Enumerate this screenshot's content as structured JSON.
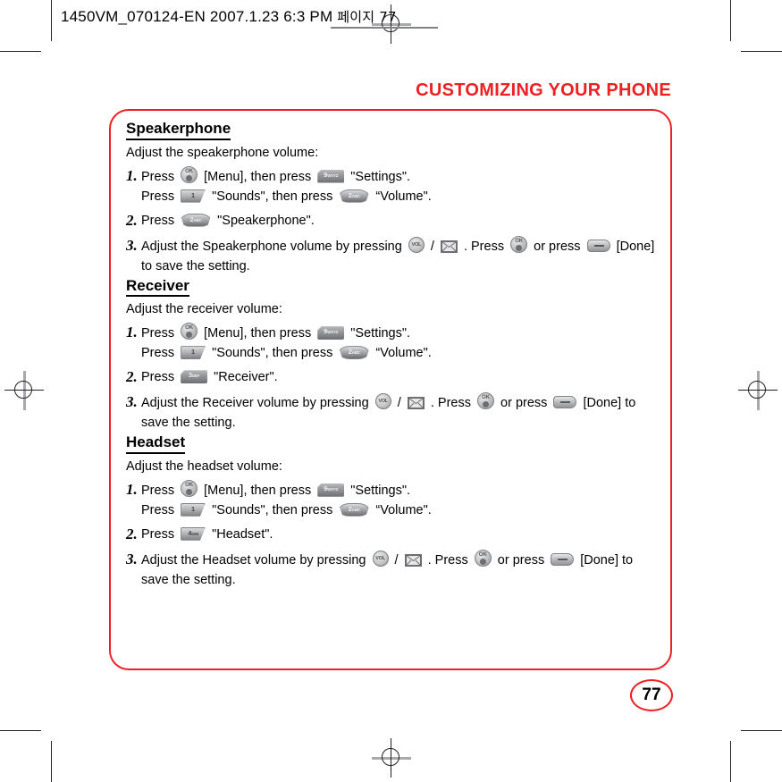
{
  "document": {
    "header_text": "1450VM_070124-EN  2007.1.23 6:3 PM",
    "header_korean": "페이지 77",
    "chapter_title": "CUSTOMIZING YOUR PHONE",
    "page_number": "77",
    "accent_color": "#ed2024"
  },
  "icons": {
    "ok_label": "OK",
    "vol_label": "VOL",
    "key_1": "1",
    "key_1_alpha": "",
    "key_2_digit": "2",
    "key_2_alpha": "ABC",
    "key_3_digit": "3",
    "key_3_alpha": "DEF",
    "key_4_digit": "4",
    "key_4_alpha": "GHI",
    "key_9_digit": "9",
    "key_9_alpha": "WXYZ"
  },
  "sections": [
    {
      "heading": "Speakerphone",
      "subtitle": "Adjust the speakerphone volume:",
      "steps": [
        {
          "number": "1.",
          "lines": [
            {
              "parts": [
                {
                  "type": "text",
                  "value": "Press "
                },
                {
                  "type": "icon",
                  "icon": "ok-key"
                },
                {
                  "type": "text",
                  "value": " [Menu], then press "
                },
                {
                  "type": "icon",
                  "icon": "key-9"
                },
                {
                  "type": "text",
                  "value": " \"Settings\"."
                }
              ]
            },
            {
              "parts": [
                {
                  "type": "text",
                  "value": "Press "
                },
                {
                  "type": "icon",
                  "icon": "key-1"
                },
                {
                  "type": "text",
                  "value": " \"Sounds\", then press "
                },
                {
                  "type": "icon",
                  "icon": "key-2"
                },
                {
                  "type": "text",
                  "value": " “Volume\"."
                }
              ]
            }
          ]
        },
        {
          "number": "2.",
          "lines": [
            {
              "parts": [
                {
                  "type": "text",
                  "value": "Press "
                },
                {
                  "type": "icon",
                  "icon": "key-2"
                },
                {
                  "type": "text",
                  "value": " \"Speakerphone\"."
                }
              ]
            }
          ]
        },
        {
          "number": "3.",
          "lines": [
            {
              "parts": [
                {
                  "type": "text",
                  "value": "Adjust the Speakerphone volume by pressing "
                },
                {
                  "type": "icon",
                  "icon": "vol-key"
                },
                {
                  "type": "text",
                  "value": " / "
                },
                {
                  "type": "icon",
                  "icon": "envelope-key"
                },
                {
                  "type": "text",
                  "value": " .  Press "
                },
                {
                  "type": "icon",
                  "icon": "ok-key"
                },
                {
                  "type": "text",
                  "value": " or press "
                },
                {
                  "type": "icon",
                  "icon": "soft-key"
                },
                {
                  "type": "text",
                  "value": " [Done] to save the setting."
                }
              ]
            }
          ]
        }
      ]
    },
    {
      "heading": "Receiver",
      "subtitle": "Adjust the receiver volume:",
      "steps": [
        {
          "number": "1.",
          "lines": [
            {
              "parts": [
                {
                  "type": "text",
                  "value": "Press "
                },
                {
                  "type": "icon",
                  "icon": "ok-key"
                },
                {
                  "type": "text",
                  "value": " [Menu], then press "
                },
                {
                  "type": "icon",
                  "icon": "key-9"
                },
                {
                  "type": "text",
                  "value": " \"Settings\"."
                }
              ]
            },
            {
              "parts": [
                {
                  "type": "text",
                  "value": "Press "
                },
                {
                  "type": "icon",
                  "icon": "key-1"
                },
                {
                  "type": "text",
                  "value": " \"Sounds\", then press "
                },
                {
                  "type": "icon",
                  "icon": "key-2"
                },
                {
                  "type": "text",
                  "value": " “Volume\"."
                }
              ]
            }
          ]
        },
        {
          "number": "2.",
          "lines": [
            {
              "parts": [
                {
                  "type": "text",
                  "value": "Press "
                },
                {
                  "type": "icon",
                  "icon": "key-3"
                },
                {
                  "type": "text",
                  "value": " \"Receiver\"."
                }
              ]
            }
          ]
        },
        {
          "number": "3.",
          "lines": [
            {
              "parts": [
                {
                  "type": "text",
                  "value": "Adjust the Receiver volume by pressing "
                },
                {
                  "type": "icon",
                  "icon": "vol-key"
                },
                {
                  "type": "text",
                  "value": " / "
                },
                {
                  "type": "icon",
                  "icon": "envelope-key"
                },
                {
                  "type": "text",
                  "value": " .  Press "
                },
                {
                  "type": "icon",
                  "icon": "ok-key"
                },
                {
                  "type": "text",
                  "value": " or press "
                },
                {
                  "type": "icon",
                  "icon": "soft-key"
                },
                {
                  "type": "text",
                  "value": " [Done] to save the setting."
                }
              ]
            }
          ]
        }
      ]
    },
    {
      "heading": "Headset",
      "subtitle": "Adjust the headset volume:",
      "steps": [
        {
          "number": "1.",
          "lines": [
            {
              "parts": [
                {
                  "type": "text",
                  "value": "Press "
                },
                {
                  "type": "icon",
                  "icon": "ok-key"
                },
                {
                  "type": "text",
                  "value": " [Menu], then press "
                },
                {
                  "type": "icon",
                  "icon": "key-9"
                },
                {
                  "type": "text",
                  "value": " \"Settings\"."
                }
              ]
            },
            {
              "parts": [
                {
                  "type": "text",
                  "value": "Press "
                },
                {
                  "type": "icon",
                  "icon": "key-1"
                },
                {
                  "type": "text",
                  "value": " \"Sounds\", then press "
                },
                {
                  "type": "icon",
                  "icon": "key-2"
                },
                {
                  "type": "text",
                  "value": " “Volume\"."
                }
              ]
            }
          ]
        },
        {
          "number": "2.",
          "lines": [
            {
              "parts": [
                {
                  "type": "text",
                  "value": "Press "
                },
                {
                  "type": "icon",
                  "icon": "key-4"
                },
                {
                  "type": "text",
                  "value": " \"Headset\"."
                }
              ]
            }
          ]
        },
        {
          "number": "3.",
          "lines": [
            {
              "parts": [
                {
                  "type": "text",
                  "value": "Adjust the Headset volume by pressing "
                },
                {
                  "type": "icon",
                  "icon": "vol-key"
                },
                {
                  "type": "text",
                  "value": " / "
                },
                {
                  "type": "icon",
                  "icon": "envelope-key"
                },
                {
                  "type": "text",
                  "value": " .  Press "
                },
                {
                  "type": "icon",
                  "icon": "ok-key"
                },
                {
                  "type": "text",
                  "value": " or press "
                },
                {
                  "type": "icon",
                  "icon": "soft-key"
                },
                {
                  "type": "text",
                  "value": " [Done] to save the setting."
                }
              ]
            }
          ]
        }
      ]
    }
  ]
}
